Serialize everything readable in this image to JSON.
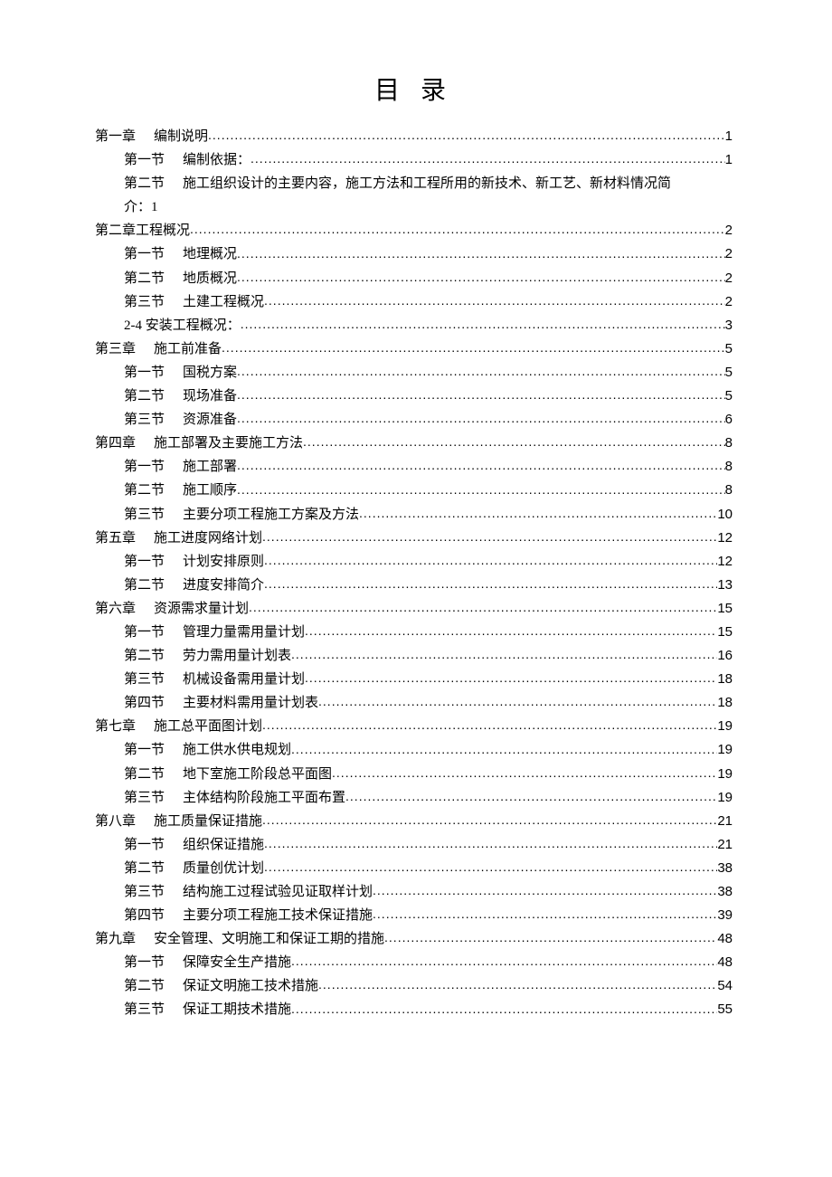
{
  "title": "目 录",
  "dots": "........................................................................................................................................................................................................................",
  "toc": [
    {
      "indent": 0,
      "prefix": "第一章",
      "text": "编制说明",
      "page": "1"
    },
    {
      "indent": 1,
      "prefix": "第一节",
      "text": "编制依据：",
      "page": "1"
    },
    {
      "indent": 1,
      "prefix": "第二节",
      "text": "施工组织设计的主要内容，施工方法和工程所用的新技术、新工艺、新材料情况简",
      "page": null,
      "cont": "介：1"
    },
    {
      "indent": 0,
      "prefix": "",
      "text": "第二章工程概况",
      "page": "2"
    },
    {
      "indent": 1,
      "prefix": "第一节",
      "text": "地理概况",
      "page": "2"
    },
    {
      "indent": 1,
      "prefix": "第二节",
      "text": "地质概况",
      "page": "2"
    },
    {
      "indent": 1,
      "prefix": "第三节",
      "text": "土建工程概况",
      "page": "2"
    },
    {
      "indent": 1,
      "prefix": "",
      "text": "2-4 安装工程概况：",
      "page": "3"
    },
    {
      "indent": 0,
      "prefix": "第三章",
      "text": "施工前准备",
      "page": "5"
    },
    {
      "indent": 1,
      "prefix": "第一节",
      "text": "国税方案",
      "page": "5"
    },
    {
      "indent": 1,
      "prefix": "第二节",
      "text": "现场准备",
      "page": "5"
    },
    {
      "indent": 1,
      "prefix": "第三节",
      "text": "资源准备",
      "page": "6"
    },
    {
      "indent": 0,
      "prefix": "第四章",
      "text": "施工部署及主要施工方法",
      "page": "8"
    },
    {
      "indent": 1,
      "prefix": "第一节",
      "text": "施工部署",
      "page": "8"
    },
    {
      "indent": 1,
      "prefix": "第二节",
      "text": "施工顺序",
      "page": "8"
    },
    {
      "indent": 1,
      "prefix": "第三节",
      "text": "主要分项工程施工方案及方法",
      "page": "10"
    },
    {
      "indent": 0,
      "prefix": "第五章",
      "text": "施工进度网络计划",
      "page": "12"
    },
    {
      "indent": 1,
      "prefix": "第一节",
      "text": "计划安排原则",
      "page": "12"
    },
    {
      "indent": 1,
      "prefix": "第二节",
      "text": "进度安排简介",
      "page": "13"
    },
    {
      "indent": 0,
      "prefix": "第六章",
      "text": "资源需求量计划",
      "page": "15"
    },
    {
      "indent": 1,
      "prefix": "第一节",
      "text": "管理力量需用量计划",
      "page": "15"
    },
    {
      "indent": 1,
      "prefix": "第二节",
      "text": "劳力需用量计划表",
      "page": "16"
    },
    {
      "indent": 1,
      "prefix": "第三节",
      "text": "机械设备需用量计划",
      "page": "18"
    },
    {
      "indent": 1,
      "prefix": "第四节",
      "text": "主要材料需用量计划表",
      "page": "18"
    },
    {
      "indent": 0,
      "prefix": "第七章",
      "text": "施工总平面图计划",
      "page": "19"
    },
    {
      "indent": 1,
      "prefix": "第一节",
      "text": "施工供水供电规划",
      "page": "19"
    },
    {
      "indent": 1,
      "prefix": "第二节",
      "text": "地下室施工阶段总平面图",
      "page": "19"
    },
    {
      "indent": 1,
      "prefix": "第三节",
      "text": "主体结构阶段施工平面布置",
      "page": "19"
    },
    {
      "indent": 0,
      "prefix": "第八章",
      "text": "施工质量保证措施",
      "page": "21"
    },
    {
      "indent": 1,
      "prefix": "第一节",
      "text": "组织保证措施",
      "page": "21"
    },
    {
      "indent": 1,
      "prefix": "第二节",
      "text": "质量创优计划",
      "page": "38"
    },
    {
      "indent": 1,
      "prefix": "第三节",
      "text": "结构施工过程试验见证取样计划",
      "page": "38"
    },
    {
      "indent": 1,
      "prefix": "第四节",
      "text": "主要分项工程施工技术保证措施",
      "page": "39"
    },
    {
      "indent": 0,
      "prefix": "第九章",
      "text": "安全管理、文明施工和保证工期的措施",
      "page": "48"
    },
    {
      "indent": 1,
      "prefix": "第一节",
      "text": "保障安全生产措施",
      "page": "48"
    },
    {
      "indent": 1,
      "prefix": "第二节",
      "text": "保证文明施工技术措施",
      "page": "54"
    },
    {
      "indent": 1,
      "prefix": "第三节",
      "text": "保证工期技术措施",
      "page": "55"
    }
  ]
}
